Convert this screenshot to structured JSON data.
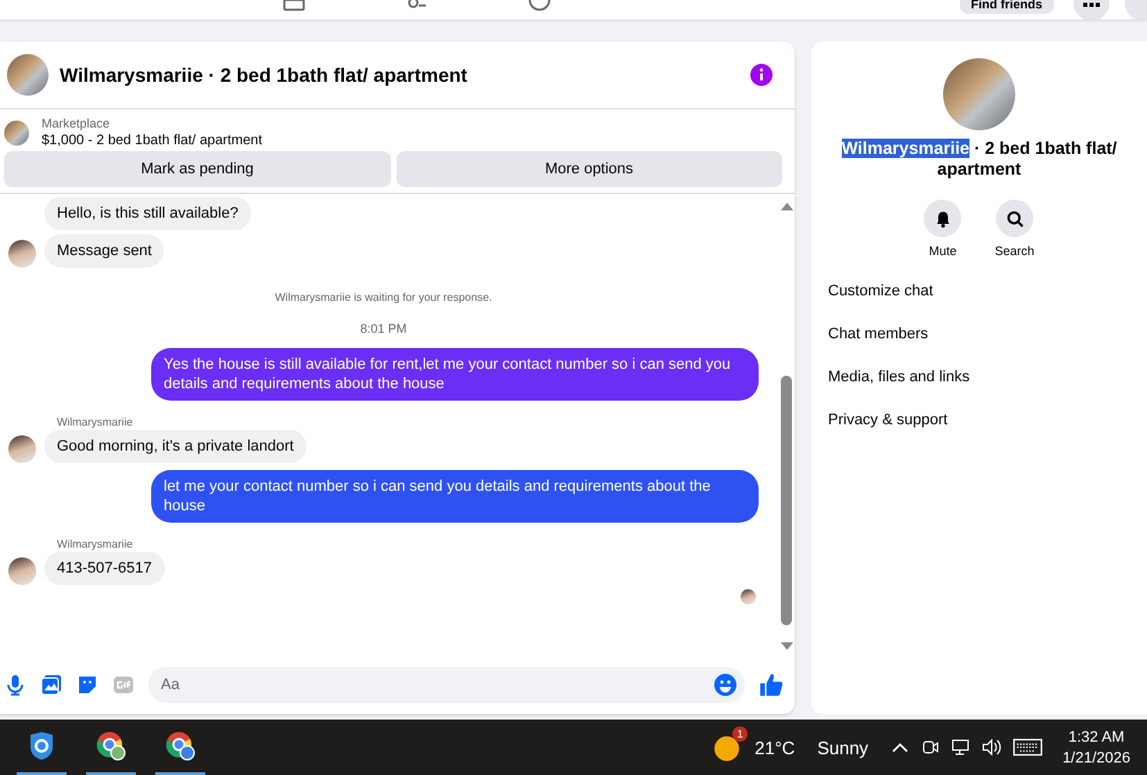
{
  "topbar": {
    "find_friends": "Find friends"
  },
  "chat": {
    "title": "Wilmarysmariie · 2 bed 1bath flat/ apartment",
    "listing": {
      "source": "Marketplace",
      "summary": "$1,000 - 2 bed 1bath flat/ apartment"
    },
    "actions": [
      "Mark as pending",
      "More options"
    ],
    "messages": [
      {
        "kind": "incoming",
        "text": "Hello, is this still available?",
        "avatar": false
      },
      {
        "kind": "incoming",
        "text": "Message sent",
        "avatar": true
      },
      {
        "kind": "system",
        "text": "Wilmarysmariie is waiting for your response."
      },
      {
        "kind": "time",
        "text": "8:01 PM"
      },
      {
        "kind": "outgoing",
        "text": "Yes the house is still available for rent,let me your contact number so i can send you details and requirements about the house",
        "color": "#6a2ef5"
      },
      {
        "kind": "sender",
        "text": "Wilmarysmariie"
      },
      {
        "kind": "incoming",
        "text": "Good morning, it's a private landort",
        "avatar": true
      },
      {
        "kind": "outgoing",
        "text": "let me your contact number so i can send you details and requirements about the house",
        "color": "#2e52f2"
      },
      {
        "kind": "sender",
        "text": "Wilmarysmariie"
      },
      {
        "kind": "incoming",
        "text": "413-507-6517",
        "avatar": true
      }
    ],
    "composer": {
      "placeholder": "Aa"
    }
  },
  "details": {
    "title_parts": [
      {
        "text": "Wilmarysmariie",
        "highlighted": true
      },
      {
        "text": " · 2 bed 1bath flat/ apartment",
        "highlighted": false
      }
    ],
    "quick_actions": [
      {
        "kind": "mute",
        "label": "Mute"
      },
      {
        "kind": "search",
        "label": "Search"
      }
    ],
    "menu": [
      "Customize chat",
      "Chat members",
      "Media, files and links",
      "Privacy & support"
    ]
  },
  "taskbar": {
    "weather_badge": "1",
    "temperature": "21°C",
    "condition": "Sunny",
    "time": "1:32 AM",
    "date": "1/21/2026"
  }
}
